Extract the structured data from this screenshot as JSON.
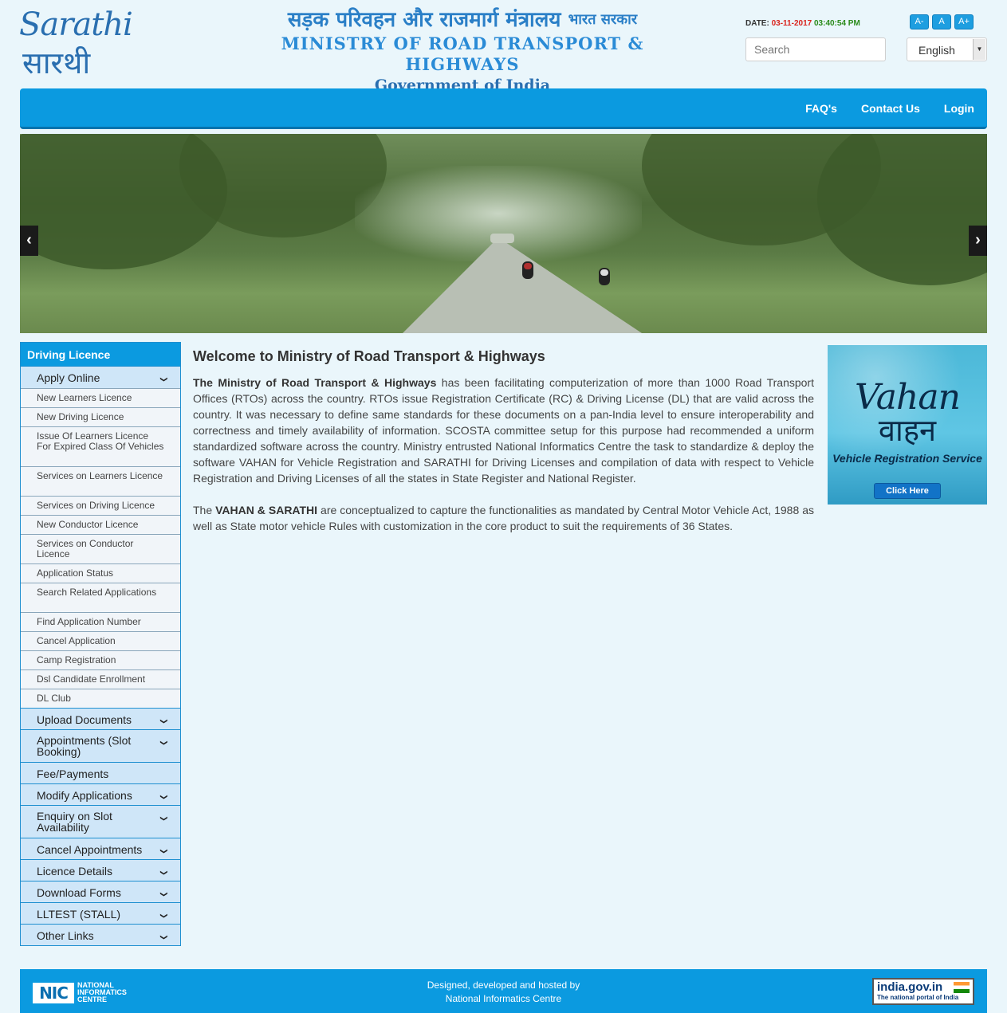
{
  "header": {
    "logo_text_latin": "Sarathi",
    "logo_text_hindi": "सारथी",
    "ministry_hindi": "सड़क परिवहन और राजमार्ग मंत्रालय",
    "ministry_hindi_gov": "भारत सरकार",
    "ministry_english": "MINISTRY OF ROAD TRANSPORT & HIGHWAYS",
    "government": "Government of India",
    "date_label": "DATE:",
    "date_value": "03-11-2017",
    "time_value": "03:40:54 PM",
    "font_buttons": [
      "A-",
      "A",
      "A+"
    ],
    "search_placeholder": "Search",
    "language_selected": "English"
  },
  "nav": {
    "links": [
      "FAQ's",
      "Contact Us",
      "Login"
    ],
    "color": "#0b9ae0"
  },
  "banner": {
    "prev_icon": "‹",
    "next_icon": "›"
  },
  "sidebar": {
    "title": "Driving Licence",
    "sections": [
      {
        "label": "Apply Online",
        "expanded": true,
        "items": [
          "New Learners Licence",
          "New Driving Licence",
          "Issue Of Learners Licence For Expired Class Of Vehicles",
          "Services on Learners Licence",
          "Services on Driving Licence",
          "New Conductor Licence",
          "Services on Conductor Licence",
          "Application Status",
          "Search Related Applications",
          "Find Application Number",
          "Cancel Application",
          "Camp Registration",
          "Dsl Candidate Enrollment",
          "DL Club"
        ]
      },
      {
        "label": "Upload Documents",
        "chevron": true
      },
      {
        "label": "Appointments (Slot Booking)",
        "chevron": true
      },
      {
        "label": "Fee/Payments",
        "chevron": false
      },
      {
        "label": "Modify Applications",
        "chevron": true
      },
      {
        "label": "Enquiry on Slot Availability",
        "chevron": true
      },
      {
        "label": "Cancel Appointments",
        "chevron": true
      },
      {
        "label": "Licence Details",
        "chevron": true
      },
      {
        "label": "Download Forms",
        "chevron": true
      },
      {
        "label": "LLTEST (STALL)",
        "chevron": true
      },
      {
        "label": "Other Links",
        "chevron": true
      }
    ]
  },
  "content": {
    "heading": "Welcome to Ministry of Road Transport & Highways",
    "p1_bold": "The Ministry of Road Transport & Highways",
    "p1_rest": " has been facilitating computerization of more than 1000 Road Transport Offices (RTOs) across the country. RTOs issue Registration Certificate (RC) & Driving License (DL) that are valid across the country. It was necessary to define same standards for these documents on a pan-India level to ensure interoperability and correctness and timely availability of information. SCOSTA committee setup for this purpose had recommended a uniform standardized software across the country. Ministry entrusted National Informatics Centre the task to standardize & deploy the software VAHAN for Vehicle Registration and SARATHI for Driving Licenses and compilation of data with respect to Vehicle Registration and Driving Licenses of all the states in State Register and National Register.",
    "p2_pre": "The ",
    "p2_bold": "VAHAN & SARATHI",
    "p2_rest": " are conceptualized to capture the functionalities as mandated by Central Motor Vehicle Act, 1988 as well as State motor vehicle Rules with customization in the core product to suit the requirements of 36 States."
  },
  "vahan_ad": {
    "title_latin": "Vahan",
    "title_hindi": "वाहन",
    "subtitle": "Vehicle Registration Service",
    "button": "Click Here"
  },
  "footer": {
    "nic_mark": "NIC",
    "nic_text": "NATIONAL INFORMATICS CENTRE",
    "line1": "Designed, developed and hosted by",
    "line2": "National Informatics Centre",
    "india_portal": "india.gov.in",
    "india_portal_sub": "The national portal of India"
  }
}
